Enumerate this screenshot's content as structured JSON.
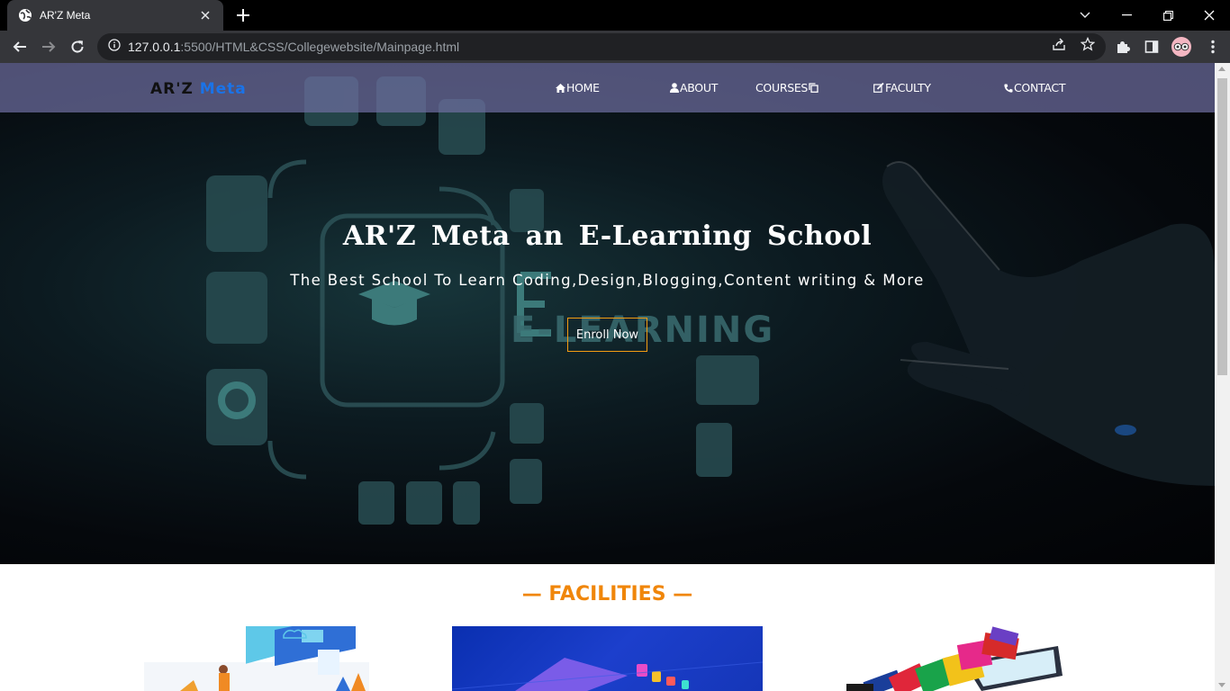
{
  "browser": {
    "tab_title": "AR'Z Meta",
    "url_host": "127.0.0.1",
    "url_path": ":5500/HTML&CSS/Collegewebsite/Mainpage.html"
  },
  "site": {
    "logo_main": "AR'Z",
    "logo_accent": "Meta",
    "nav": {
      "home": "HOME",
      "about": "ABOUT",
      "courses": "COURSES",
      "faculty": "FACULTY",
      "contact": "CONTACT"
    },
    "hero": {
      "title": "AR'Z Meta an E-Learning School",
      "subtitle": "The Best School To Learn Coding,Design,Blogging,Content writing & More",
      "cta": "Enroll Now",
      "graphic_text": "E-LEARNING"
    },
    "facilities": {
      "heading": "— FACILITIES —"
    }
  },
  "colors": {
    "accent_orange": "#f0860a",
    "logo_blue": "#1a73e8",
    "navbar_bg": "rgba(110,110,160,0.72)"
  }
}
